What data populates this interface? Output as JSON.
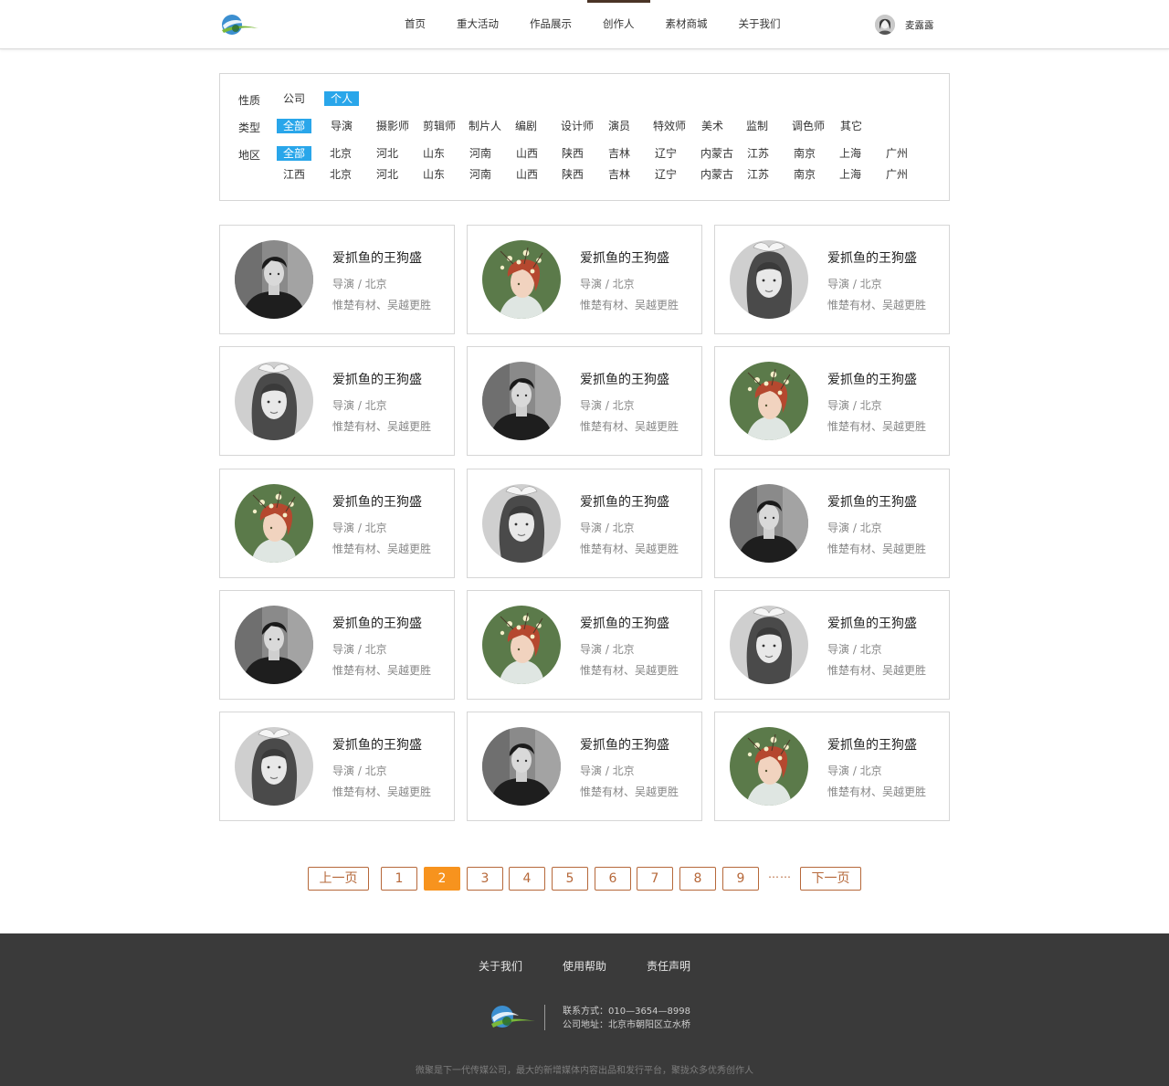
{
  "header": {
    "nav": [
      "首页",
      "重大活动",
      "作品展示",
      "创作人",
      "素材商城",
      "关于我们"
    ],
    "active_nav_index": 3,
    "user_name": "麦露露"
  },
  "filter": {
    "nature": {
      "label": "性质",
      "options": [
        "公司",
        "个人"
      ],
      "selected": "个人"
    },
    "type": {
      "label": "类型",
      "options": [
        "全部",
        "导演",
        "摄影师",
        "剪辑师",
        "制片人",
        "编剧",
        "设计师",
        "演员",
        "特效师",
        "美术",
        "监制",
        "调色师",
        "其它"
      ],
      "selected": "全部"
    },
    "region": {
      "label": "地区",
      "row1": [
        "全部",
        "北京",
        "河北",
        "山东",
        "河南",
        "山西",
        "陕西",
        "吉林",
        "辽宁",
        "内蒙古",
        "江苏",
        "南京",
        "上海",
        "广州"
      ],
      "row2": [
        "江西",
        "北京",
        "河北",
        "山东",
        "河南",
        "山西",
        "陕西",
        "吉林",
        "辽宁",
        "内蒙古",
        "江苏",
        "南京",
        "上海",
        "广州"
      ],
      "selected": "全部"
    },
    "accent_color": "#29a6ea"
  },
  "creators": [
    {
      "name": "爱抓鱼的王狗盛",
      "role": "导演 / 北京",
      "tags": "惟楚有材、吴越更胜",
      "avatar": "man-portrait-icon"
    },
    {
      "name": "爱抓鱼的王狗盛",
      "role": "导演 / 北京",
      "tags": "惟楚有材、吴越更胜",
      "avatar": "flower-girl-illustration-icon"
    },
    {
      "name": "爱抓鱼的王狗盛",
      "role": "导演 / 北京",
      "tags": "惟楚有材、吴越更胜",
      "avatar": "woman-portrait-icon"
    },
    {
      "name": "爱抓鱼的王狗盛",
      "role": "导演 / 北京",
      "tags": "惟楚有材、吴越更胜",
      "avatar": "woman-portrait-icon"
    },
    {
      "name": "爱抓鱼的王狗盛",
      "role": "导演 / 北京",
      "tags": "惟楚有材、吴越更胜",
      "avatar": "man-portrait-icon"
    },
    {
      "name": "爱抓鱼的王狗盛",
      "role": "导演 / 北京",
      "tags": "惟楚有材、吴越更胜",
      "avatar": "flower-girl-illustration-icon"
    },
    {
      "name": "爱抓鱼的王狗盛",
      "role": "导演 / 北京",
      "tags": "惟楚有材、吴越更胜",
      "avatar": "flower-girl-illustration-icon"
    },
    {
      "name": "爱抓鱼的王狗盛",
      "role": "导演 / 北京",
      "tags": "惟楚有材、吴越更胜",
      "avatar": "woman-portrait-icon"
    },
    {
      "name": "爱抓鱼的王狗盛",
      "role": "导演 / 北京",
      "tags": "惟楚有材、吴越更胜",
      "avatar": "man-portrait-icon"
    },
    {
      "name": "爱抓鱼的王狗盛",
      "role": "导演 / 北京",
      "tags": "惟楚有材、吴越更胜",
      "avatar": "man-portrait-icon"
    },
    {
      "name": "爱抓鱼的王狗盛",
      "role": "导演 / 北京",
      "tags": "惟楚有材、吴越更胜",
      "avatar": "flower-girl-illustration-icon"
    },
    {
      "name": "爱抓鱼的王狗盛",
      "role": "导演 / 北京",
      "tags": "惟楚有材、吴越更胜",
      "avatar": "woman-portrait-icon"
    },
    {
      "name": "爱抓鱼的王狗盛",
      "role": "导演 / 北京",
      "tags": "惟楚有材、吴越更胜",
      "avatar": "woman-portrait-icon"
    },
    {
      "name": "爱抓鱼的王狗盛",
      "role": "导演 / 北京",
      "tags": "惟楚有材、吴越更胜",
      "avatar": "man-portrait-icon"
    },
    {
      "name": "爱抓鱼的王狗盛",
      "role": "导演 / 北京",
      "tags": "惟楚有材、吴越更胜",
      "avatar": "flower-girl-illustration-icon"
    }
  ],
  "pagination": {
    "prev": "上一页",
    "pages": [
      "1",
      "2",
      "3",
      "4",
      "5",
      "6",
      "7",
      "8",
      "9"
    ],
    "current": "2",
    "ellipsis": "……",
    "next": "下一页",
    "accent_color": "#f7931e",
    "border_color": "#b6683a"
  },
  "footer": {
    "links": [
      "关于我们",
      "使用帮助",
      "责任声明"
    ],
    "contact_phone": "联系方式：010—3654—8998",
    "contact_address": "公司地址：北京市朝阳区立水桥",
    "copyright": "微聚是下一代传媒公司，最大的新增媒体内容出品和发行平台，聚拢众多优秀创作人",
    "background": "#3a3a3a"
  }
}
